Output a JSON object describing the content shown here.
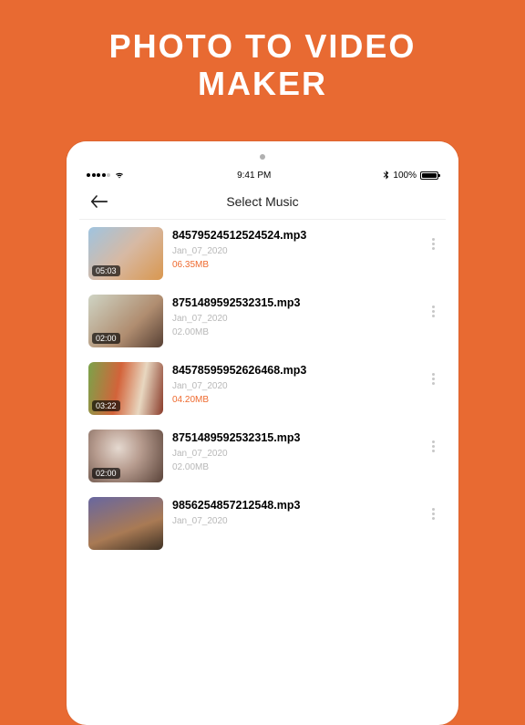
{
  "hero": {
    "line1": "PHOTO TO VIDEO",
    "line2": "MAKER"
  },
  "status": {
    "time": "9:41 PM",
    "battery": "100%"
  },
  "header": {
    "title": "Select Music"
  },
  "items": [
    {
      "duration": "05:03",
      "filename": "84579524512524524.mp3",
      "date": "Jan_07_2020",
      "size": "06.35MB",
      "sizeTone": "orange"
    },
    {
      "duration": "02:00",
      "filename": "8751489592532315.mp3",
      "date": "Jan_07_2020",
      "size": "02.00MB",
      "sizeTone": "gray"
    },
    {
      "duration": "03:22",
      "filename": "84578595952626468.mp3",
      "date": "Jan_07_2020",
      "size": "04.20MB",
      "sizeTone": "orange"
    },
    {
      "duration": "02:00",
      "filename": "8751489592532315.mp3",
      "date": "Jan_07_2020",
      "size": "02.00MB",
      "sizeTone": "gray"
    },
    {
      "duration": "",
      "filename": "9856254857212548.mp3",
      "date": "Jan_07_2020",
      "size": "",
      "sizeTone": "gray"
    }
  ]
}
